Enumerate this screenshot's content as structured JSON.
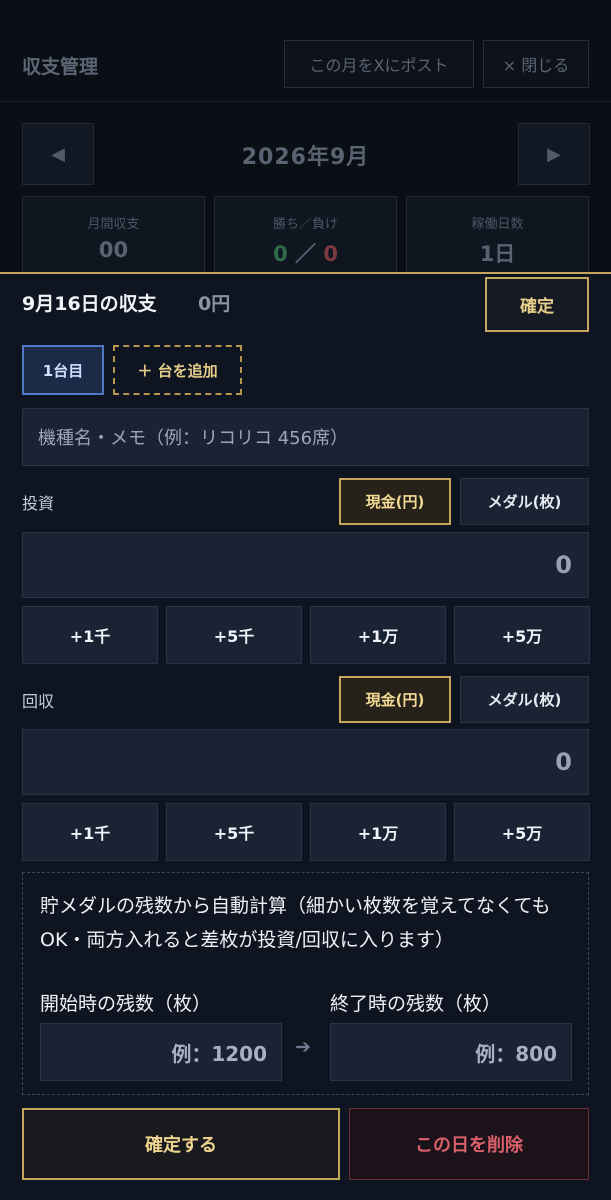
{
  "background": {
    "title": "収支管理",
    "post_button": "この月をXにポスト",
    "close_button": "× 閉じる",
    "prev_icon": "◀",
    "next_icon": "▶",
    "month": "2026年9月",
    "stats": [
      {
        "label": "月間収支",
        "value": "00"
      },
      {
        "label": "勝ち／負け",
        "win": "0",
        "separator": "／",
        "lose": "0"
      },
      {
        "label": "稼働日数",
        "value": "1日"
      }
    ]
  },
  "sheet": {
    "title": "9月16日の収支",
    "amount": "0円",
    "confirm_label": "確定",
    "tabs": {
      "first": "1台目",
      "add": "＋ 台を追加"
    },
    "memo_placeholder": "機種名・メモ（例：リコリコ 456席）",
    "investment": {
      "label": "投資",
      "unit_yen": "現金(円)",
      "unit_medal": "メダル(枚)",
      "value": "0",
      "quick": [
        "+1千",
        "+5千",
        "+1万",
        "+5万"
      ]
    },
    "return": {
      "label": "回収",
      "unit_yen": "現金(円)",
      "unit_medal": "メダル(枚)",
      "value": "0",
      "quick": [
        "+1千",
        "+5千",
        "+1万",
        "+5万"
      ]
    },
    "auto_calc": {
      "description": "貯メダルの残数から自動計算（細かい枚数を覚えてなくてもOK・両方入れると差枚が投資/回収に入ります）",
      "start_label": "開始時の残数（枚）",
      "end_label": "終了時の残数（枚）",
      "start_placeholder": "例：1200",
      "end_placeholder": "例：800",
      "arrow": "➔"
    },
    "save_label": "確定する",
    "delete_label": "この日を削除"
  },
  "colors": {
    "accent": "#c6a55c",
    "win": "#2f6b47",
    "lose": "#7d3a3e",
    "danger": "#d9606a"
  }
}
